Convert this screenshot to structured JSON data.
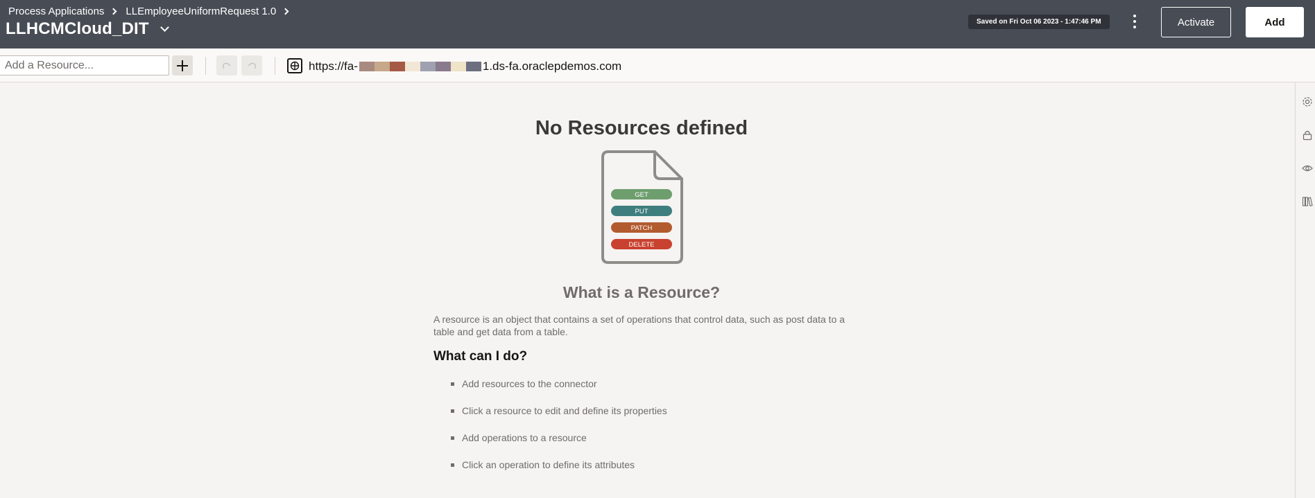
{
  "header": {
    "breadcrumb": [
      "Process Applications",
      "LLEmployeeUniformRequest 1.0"
    ],
    "app_title": "LLHCMCloud_DIT",
    "saved_text": "Saved on Fri Oct 06 2023 - 1:47:46 PM",
    "activate_label": "Activate",
    "add_label": "Add"
  },
  "toolbar": {
    "resource_placeholder": "Add a Resource...",
    "url_prefix": "https://fa-",
    "url_suffix": "1.ds-fa.oraclepdemos.com"
  },
  "empty_state": {
    "title": "No Resources defined",
    "methods": [
      "GET",
      "PUT",
      "PATCH",
      "DELETE"
    ],
    "method_colors": [
      "#6e9e6e",
      "#3f7e7e",
      "#b25b2f",
      "#c9412f"
    ],
    "what_is_title": "What is a Resource?",
    "description": "A resource is an object that contains a set of operations that control data, such as post data to a table and get data from a table.",
    "what_can_title": "What can I do?",
    "tips": [
      "Add resources to the connector",
      "Click a resource to edit and define its properties",
      "Add operations to a resource",
      "Click an operation to define its attributes"
    ]
  },
  "right_rail": {
    "icons": [
      "settings-icon",
      "lock-icon",
      "eye-icon",
      "library-icon"
    ]
  }
}
